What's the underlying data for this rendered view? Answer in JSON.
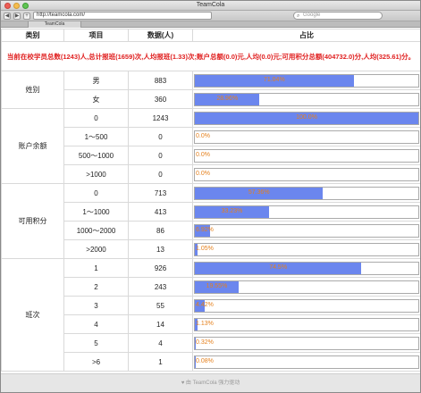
{
  "window": {
    "title": "TeamCola",
    "tab": "TeamCola",
    "url": "http://teamcola.com/",
    "search_placeholder": "Google"
  },
  "table": {
    "headers": [
      "类别",
      "项目",
      "数据(人)",
      "占比"
    ],
    "summary": "当前在校学员总数(1243)人,总计报班(1659)次,人均报班(1.33)次;账户总额(0.0)元,人均(0.0)元;可用积分总额(404732.0)分,人均(325.61)分。",
    "groups": [
      {
        "category": "姓别",
        "rows": [
          {
            "item": "男",
            "count": "883",
            "percent": "71.04%",
            "fraction": 0.7104
          },
          {
            "item": "女",
            "count": "360",
            "percent": "28.96%",
            "fraction": 0.2896
          }
        ]
      },
      {
        "category": "账户余额",
        "rows": [
          {
            "item": "0",
            "count": "1243",
            "percent": "100.0%",
            "fraction": 1.0
          },
          {
            "item": "1～500",
            "count": "0",
            "percent": "0.0%",
            "fraction": 0
          },
          {
            "item": "500～1000",
            "count": "0",
            "percent": "0.0%",
            "fraction": 0
          },
          {
            "item": ">1000",
            "count": "0",
            "percent": "0.0%",
            "fraction": 0
          }
        ]
      },
      {
        "category": "可用积分",
        "rows": [
          {
            "item": "0",
            "count": "713",
            "percent": "57.36%",
            "fraction": 0.5736
          },
          {
            "item": "1～1000",
            "count": "413",
            "percent": "33.23%",
            "fraction": 0.3323
          },
          {
            "item": "1000～2000",
            "count": "86",
            "percent": "6.92%",
            "fraction": 0.0692
          },
          {
            "item": ">2000",
            "count": "13",
            "percent": "1.05%",
            "fraction": 0.0105
          }
        ]
      },
      {
        "category": "班次",
        "rows": [
          {
            "item": "1",
            "count": "926",
            "percent": "74.5%",
            "fraction": 0.745
          },
          {
            "item": "2",
            "count": "243",
            "percent": "19.55%",
            "fraction": 0.1955
          },
          {
            "item": "3",
            "count": "55",
            "percent": "4.42%",
            "fraction": 0.0442
          },
          {
            "item": "4",
            "count": "14",
            "percent": "1.13%",
            "fraction": 0.0113
          },
          {
            "item": "5",
            "count": "4",
            "percent": "0.32%",
            "fraction": 0.0032
          },
          {
            "item": ">6",
            "count": "1",
            "percent": "0.08%",
            "fraction": 0.0008
          }
        ]
      }
    ]
  },
  "footer": "♥ 由 TeamCola 强力驱动",
  "colors": {
    "bar": "#6b86ee",
    "percent_text": "#e5801d",
    "summary_text": "#e02020"
  }
}
